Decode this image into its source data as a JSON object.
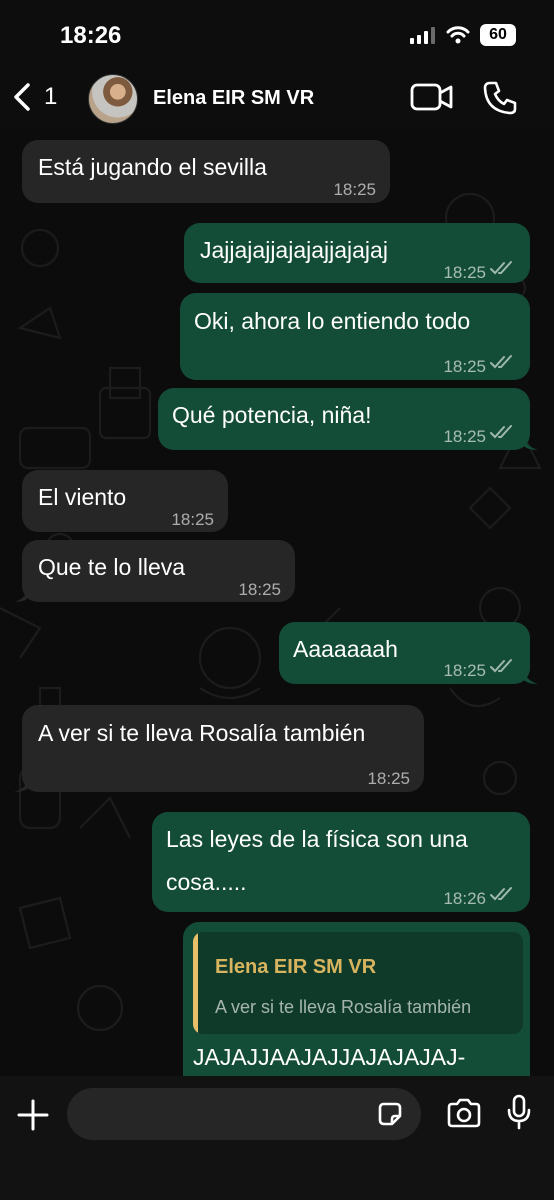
{
  "status_bar": {
    "time": "18:26",
    "battery": "60"
  },
  "header": {
    "back_count": "1",
    "contact_name": "Elena EIR SM VR"
  },
  "messages": [
    {
      "dir": "in",
      "text": "Está jugando el sevilla",
      "time": "18:25"
    },
    {
      "dir": "out",
      "text": "Jajjajajjajajajjajajaj",
      "time": "18:25",
      "read": true
    },
    {
      "dir": "out",
      "text": "Oki, ahora lo entiendo todo",
      "time": "18:25",
      "read": true
    },
    {
      "dir": "out",
      "text": "Qué potencia,  niña!",
      "time": "18:25",
      "read": true
    },
    {
      "dir": "in",
      "text": "El viento",
      "time": "18:25"
    },
    {
      "dir": "in",
      "text": "Que te lo lleva",
      "time": "18:25"
    },
    {
      "dir": "out",
      "text": "Aaaaaaah",
      "time": "18:25",
      "read": true
    },
    {
      "dir": "in",
      "text": "A ver si te lleva Rosalía también",
      "time": "18:25"
    },
    {
      "dir": "out",
      "text_lines": [
        "Las leyes de la física son una",
        "cosa....."
      ],
      "time": "18:26",
      "read": true
    },
    {
      "dir": "out",
      "reply": {
        "author": "Elena EIR SM VR",
        "text": "A ver si te lleva Rosalía también"
      },
      "text": "JAJAJJAAJAJJAJAJAJAJ-"
    }
  ],
  "composer": {
    "placeholder": ""
  },
  "icons": {
    "back": "chevron-left-icon",
    "video": "video-camera-icon",
    "call": "phone-icon",
    "plus": "plus-icon",
    "sticker": "sticker-icon",
    "camera": "camera-icon",
    "mic": "microphone-icon",
    "read_receipt": "double-check-icon"
  },
  "colors": {
    "incoming": "#262626",
    "outgoing": "#144d37",
    "quote_accent": "#e8c06a",
    "background": "#0c0c0c"
  }
}
